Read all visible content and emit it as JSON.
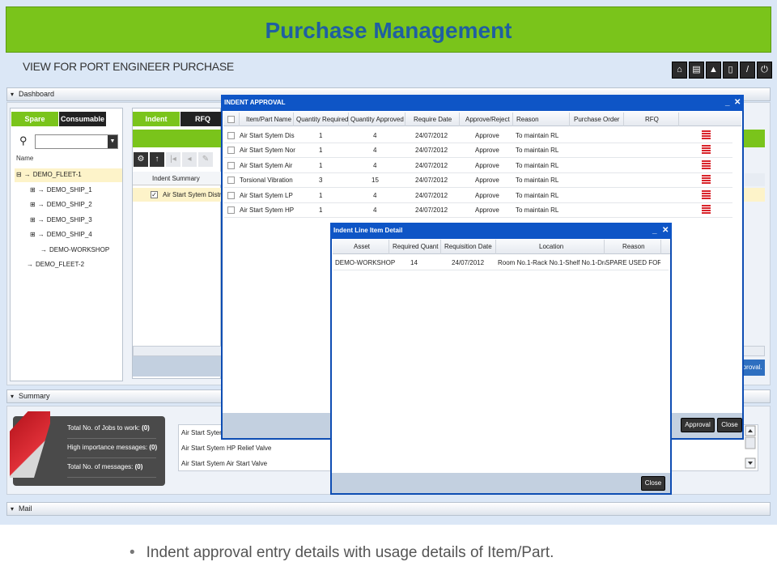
{
  "header": {
    "title": "Purchase Management",
    "subtitle": "VIEW FOR PORT ENGINEER PURCHASE"
  },
  "toolbar_icons": [
    "home-icon",
    "print-icon",
    "warning-icon",
    "document-icon",
    "edit-icon",
    "power-icon"
  ],
  "panels": {
    "dashboard": "Dashboard",
    "summary": "Summary",
    "mail": "Mail"
  },
  "left": {
    "tabs": [
      "Spare",
      "Consumable"
    ],
    "name_header": "Name",
    "tree": [
      "DEMO_FLEET-1",
      "DEMO_SHIP_1",
      "DEMO_SHIP_2",
      "DEMO_SHIP_3",
      "DEMO_SHIP_4",
      "DEMO-WORKSHOP",
      "DEMO_FLEET-2"
    ]
  },
  "middle": {
    "tabs": [
      "Indent",
      "RFQ"
    ],
    "column": "Indent Summary",
    "row": "Air Start Sytem Distributor"
  },
  "right_button": "pproval.",
  "summary": {
    "stats": [
      {
        "label": "Total No. of Jobs to work:",
        "value": "(0)"
      },
      {
        "label": "High importance messages:",
        "value": "(0)"
      },
      {
        "label": "Total No. of messages:",
        "value": "(0)"
      }
    ],
    "list": [
      "Air Start Sytem",
      "Air Start Sytem HP Relief Valve",
      "Air Start Sytem Air Start Valve"
    ]
  },
  "indent_approval": {
    "title": "INDENT APPROVAL",
    "columns": [
      "Item/Part Name",
      "Quantity Required",
      "Quantity Approved",
      "Require Date",
      "Approve/Reject",
      "Reason",
      "Purchase Order",
      "RFQ"
    ],
    "rows": [
      {
        "item": "Air Start Sytem Dis",
        "qreq": "1",
        "qapp": "4",
        "date": "24/07/2012",
        "status": "Approve",
        "reason": "To maintain RL"
      },
      {
        "item": "Air Start Sytem Nor",
        "qreq": "1",
        "qapp": "4",
        "date": "24/07/2012",
        "status": "Approve",
        "reason": "To maintain RL"
      },
      {
        "item": "Air Start Sytem Air",
        "qreq": "1",
        "qapp": "4",
        "date": "24/07/2012",
        "status": "Approve",
        "reason": "To maintain RL"
      },
      {
        "item": "Torsional Vibration",
        "qreq": "3",
        "qapp": "15",
        "date": "24/07/2012",
        "status": "Approve",
        "reason": "To maintain RL"
      },
      {
        "item": "Air Start Sytem LP",
        "qreq": "1",
        "qapp": "4",
        "date": "24/07/2012",
        "status": "Approve",
        "reason": "To maintain RL"
      },
      {
        "item": "Air Start Sytem HP",
        "qreq": "1",
        "qapp": "4",
        "date": "24/07/2012",
        "status": "Approve",
        "reason": "To maintain RL"
      }
    ],
    "buttons": {
      "approval": "Approval",
      "close": "Close"
    }
  },
  "line_item": {
    "title": "Indent Line Item Detail",
    "columns": [
      "Asset",
      "Required Quant",
      "Requisition Date",
      "Location",
      "Reason"
    ],
    "row": {
      "asset": "DEMO-WORKSHOP",
      "qty": "14",
      "date": "24/07/2012",
      "location": "Room No.1-Rack No.1-Shelf No.1-Drav",
      "reason": "SPARE USED FOR J("
    },
    "close": "Close"
  },
  "caption": "Indent approval entry details with usage details of Item/Part.",
  "colors": {
    "green": "#7ac41b",
    "title_blue": "#1f5fa1",
    "window_blue": "#0e55c6",
    "dark": "#333333"
  }
}
